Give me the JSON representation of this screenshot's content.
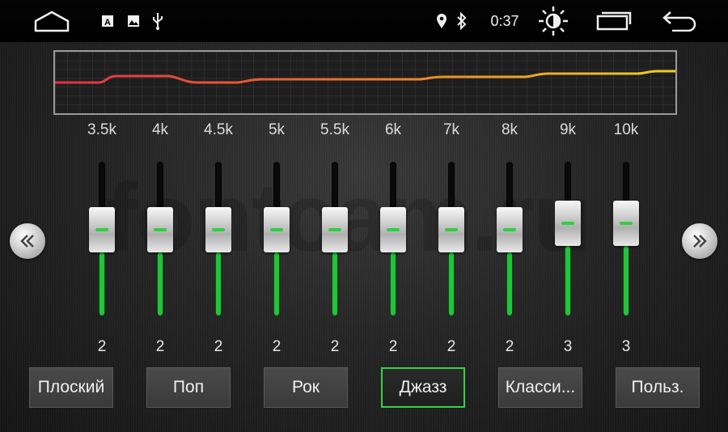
{
  "statusbar": {
    "time": "0:37",
    "icons": [
      "home-icon",
      "a-badge-icon",
      "image-icon",
      "usb-icon",
      "location-icon",
      "bluetooth-icon",
      "brightness-icon",
      "recent-apps-icon",
      "back-icon"
    ]
  },
  "watermark": "fontcam.ru",
  "curve": {
    "colors_start": "#e0304a",
    "colors_end": "#f0d020",
    "grid": true
  },
  "bands": [
    {
      "freq": "3.5k",
      "value": "2",
      "level": 2
    },
    {
      "freq": "4k",
      "value": "2",
      "level": 2
    },
    {
      "freq": "4.5k",
      "value": "2",
      "level": 2
    },
    {
      "freq": "5k",
      "value": "2",
      "level": 2
    },
    {
      "freq": "5.5k",
      "value": "2",
      "level": 2
    },
    {
      "freq": "6k",
      "value": "2",
      "level": 2
    },
    {
      "freq": "7k",
      "value": "2",
      "level": 2
    },
    {
      "freq": "8k",
      "value": "2",
      "level": 2
    },
    {
      "freq": "9k",
      "value": "3",
      "level": 3
    },
    {
      "freq": "10k",
      "value": "3",
      "level": 3
    }
  ],
  "nav": {
    "prev_icon": "chevron-left-double-icon",
    "next_icon": "chevron-right-double-icon"
  },
  "presets": [
    {
      "label": "Плоский",
      "active": false
    },
    {
      "label": "Поп",
      "active": false
    },
    {
      "label": "Рок",
      "active": false
    },
    {
      "label": "Джазз",
      "active": true
    },
    {
      "label": "Класси...",
      "active": false
    },
    {
      "label": "Польз.",
      "active": false
    }
  ],
  "accent": "#36d24a"
}
